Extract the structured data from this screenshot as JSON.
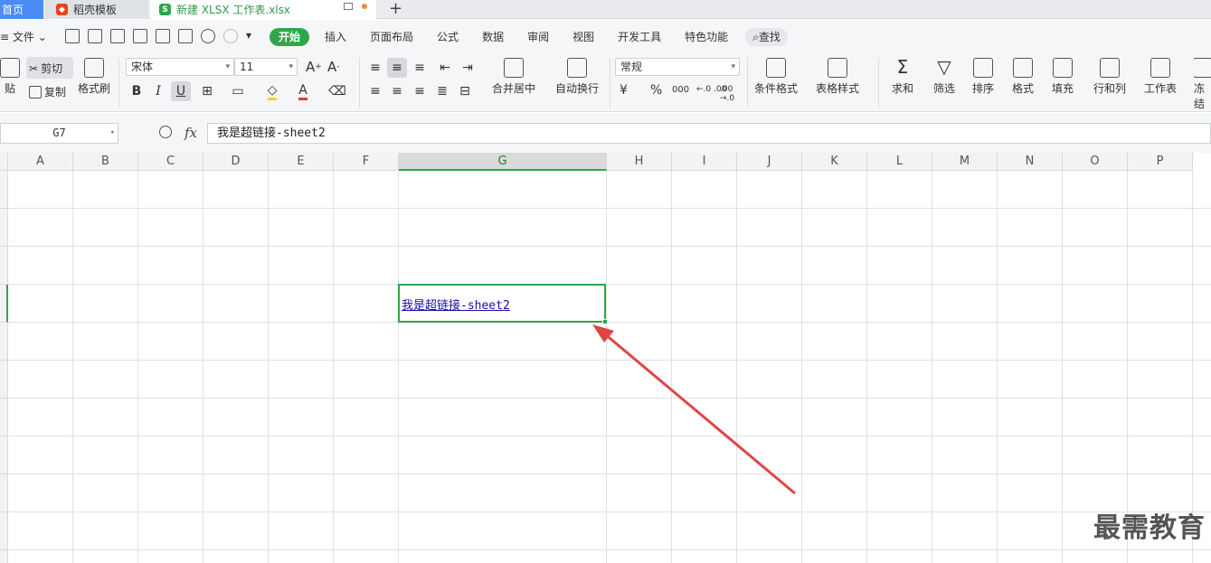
{
  "tabs": {
    "home": "首页",
    "template": "稻壳模板",
    "file": "新建 XLSX 工作表.xlsx",
    "add": "+"
  },
  "menu": {
    "file": "文件",
    "items": [
      "开始",
      "插入",
      "页面布局",
      "公式",
      "数据",
      "审阅",
      "视图",
      "开发工具",
      "特色功能"
    ],
    "search": "查找"
  },
  "ribbon": {
    "paste": "贴",
    "cut": "剪切",
    "copy": "复制",
    "format_painter": "格式刷",
    "font_name": "宋体",
    "font_size": "11",
    "merge_center": "合并居中",
    "auto_wrap": "自动换行",
    "number_format": "常规",
    "conditional_format": "条件格式",
    "table_style": "表格样式",
    "sum": "求和",
    "filter": "筛选",
    "sort": "排序",
    "format": "格式",
    "fill": "填充",
    "row_col": "行和列",
    "worksheet": "工作表",
    "freeze": "冻结",
    "currency": "¥",
    "percent": "%",
    "thousands": "000",
    "inc_dec": "←.0 .00",
    "dec_dec": ".00 →.0",
    "font_grow": "A",
    "font_shrink": "A",
    "bold": "B",
    "italic": "I",
    "underline": "U"
  },
  "formula_bar": {
    "cell_ref": "G7",
    "fx": "fx",
    "value": "我是超链接-sheet2"
  },
  "columns": [
    "A",
    "B",
    "C",
    "D",
    "E",
    "F",
    "G",
    "H",
    "I",
    "J",
    "K",
    "L",
    "M",
    "N",
    "O",
    "P"
  ],
  "active_column": "G",
  "cell": {
    "ref": "G7",
    "text": "我是超链接-sheet2"
  },
  "watermark": "最需教育",
  "colors": {
    "accent": "#2fa64a",
    "link": "#1a0dab",
    "annotation_arrow": "#e04545"
  }
}
